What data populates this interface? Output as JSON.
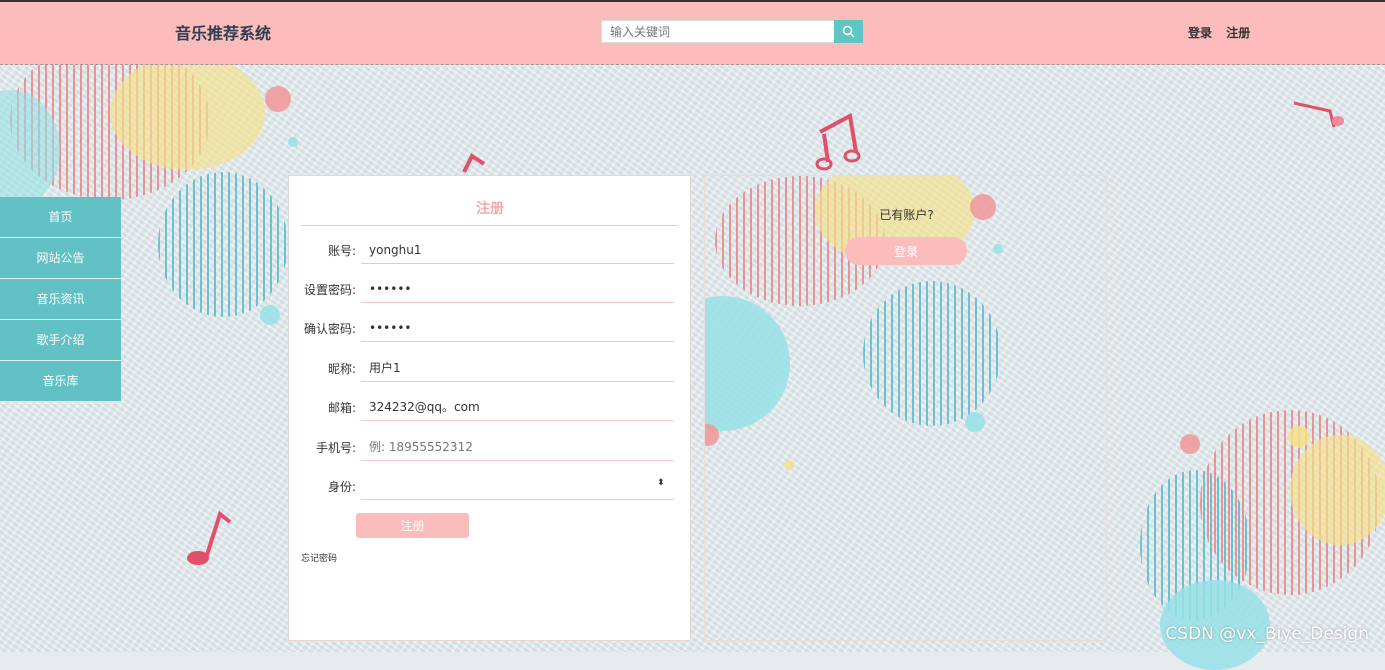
{
  "header": {
    "brand": "音乐推荐系统",
    "search_placeholder": "输入关键词",
    "login_link": "登录",
    "register_link": "注册"
  },
  "sidenav": {
    "items": [
      {
        "label": "首页"
      },
      {
        "label": "网站公告"
      },
      {
        "label": "音乐资讯"
      },
      {
        "label": "歌手介绍"
      },
      {
        "label": "音乐库"
      }
    ]
  },
  "register": {
    "title": "注册",
    "fields": [
      {
        "label": "账号:",
        "value": "yonghu1",
        "placeholder": ""
      },
      {
        "label": "设置密码:",
        "value": "••••••",
        "placeholder": ""
      },
      {
        "label": "确认密码:",
        "value": "••••••",
        "placeholder": ""
      },
      {
        "label": "昵称:",
        "value": "用户1",
        "placeholder": ""
      },
      {
        "label": "邮箱:",
        "value": "324232@qq。com",
        "placeholder": ""
      },
      {
        "label": "手机号:",
        "value": "",
        "placeholder": "例: 18955552312"
      },
      {
        "label": "身份:",
        "value": "",
        "placeholder": ""
      }
    ],
    "submit_label": "注册",
    "forgot_label": "忘记密码"
  },
  "login_panel": {
    "prompt": "已有账户?",
    "login_button": "登录"
  },
  "watermark": "CSDN @vx_Biye_Design",
  "colors": {
    "header_bg": "#fdbcbc",
    "nav_bg": "#61c1c4",
    "accent_pink": "#fdbcbc",
    "search_button": "#5fc5c5"
  }
}
